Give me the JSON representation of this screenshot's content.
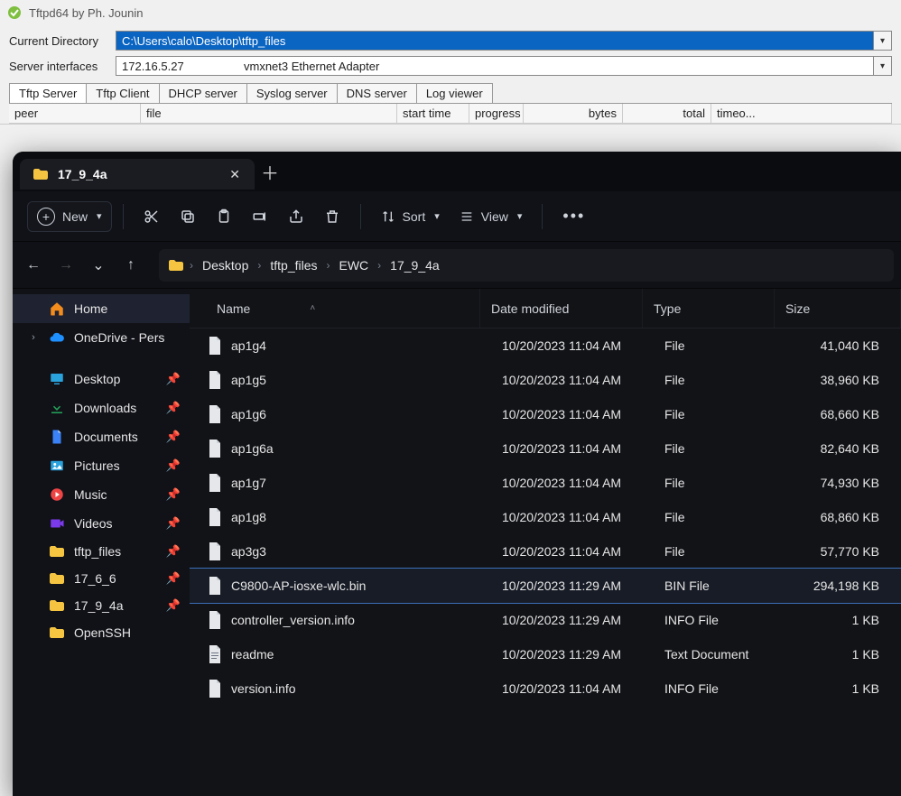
{
  "tftp": {
    "title": "Tftpd64 by Ph. Jounin",
    "dir_label": "Current Directory",
    "dir_value": "C:\\Users\\calo\\Desktop\\tftp_files",
    "iface_label": "Server interfaces",
    "iface_ip": "172.16.5.27",
    "iface_desc": "vmxnet3 Ethernet Adapter",
    "tabs": [
      "Tftp Server",
      "Tftp Client",
      "DHCP server",
      "Syslog server",
      "DNS server",
      "Log viewer"
    ],
    "cols": {
      "peer": "peer",
      "file": "file",
      "start": "start time",
      "progress": "progress",
      "bytes": "bytes",
      "total": "total",
      "timeo": "timeo..."
    }
  },
  "explorer": {
    "tab_label": "17_9_4a",
    "toolbar": {
      "new": "New",
      "sort": "Sort",
      "view": "View"
    },
    "breadcrumb": [
      "Desktop",
      "tftp_files",
      "EWC",
      "17_9_4a"
    ],
    "side": {
      "home": "Home",
      "onedrive": "OneDrive - Pers",
      "desktop": "Desktop",
      "downloads": "Downloads",
      "documents": "Documents",
      "pictures": "Pictures",
      "music": "Music",
      "videos": "Videos",
      "tftp_files": "tftp_files",
      "v1766": "17_6_6",
      "v1794a": "17_9_4a",
      "openssh": "OpenSSH"
    },
    "cols": {
      "name": "Name",
      "date": "Date modified",
      "type": "Type",
      "size": "Size"
    },
    "files": [
      {
        "name": "ap1g4",
        "date": "10/20/2023 11:04 AM",
        "type": "File",
        "size": "41,040 KB"
      },
      {
        "name": "ap1g5",
        "date": "10/20/2023 11:04 AM",
        "type": "File",
        "size": "38,960 KB"
      },
      {
        "name": "ap1g6",
        "date": "10/20/2023 11:04 AM",
        "type": "File",
        "size": "68,660 KB"
      },
      {
        "name": "ap1g6a",
        "date": "10/20/2023 11:04 AM",
        "type": "File",
        "size": "82,640 KB"
      },
      {
        "name": "ap1g7",
        "date": "10/20/2023 11:04 AM",
        "type": "File",
        "size": "74,930 KB"
      },
      {
        "name": "ap1g8",
        "date": "10/20/2023 11:04 AM",
        "type": "File",
        "size": "68,860 KB"
      },
      {
        "name": "ap3g3",
        "date": "10/20/2023 11:04 AM",
        "type": "File",
        "size": "57,770 KB"
      },
      {
        "name": "C9800-AP-iosxe-wlc.bin",
        "date": "10/20/2023 11:29 AM",
        "type": "BIN File",
        "size": "294,198 KB",
        "selected": true
      },
      {
        "name": "controller_version.info",
        "date": "10/20/2023 11:29 AM",
        "type": "INFO File",
        "size": "1 KB"
      },
      {
        "name": "readme",
        "date": "10/20/2023 11:29 AM",
        "type": "Text Document",
        "size": "1 KB",
        "icon": "text"
      },
      {
        "name": "version.info",
        "date": "10/20/2023 11:04 AM",
        "type": "INFO File",
        "size": "1 KB"
      }
    ]
  }
}
